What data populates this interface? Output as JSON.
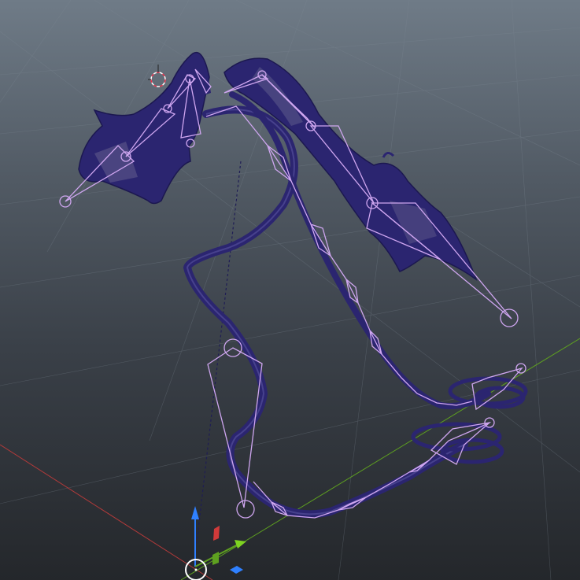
{
  "viewport": {
    "view": "perspective",
    "selection_state": "rigged-model",
    "colors": {
      "background_top": "#6f7b87",
      "background_bottom": "#24272b",
      "grid_line": "#7a8590",
      "mesh": "#2a2470",
      "bone": "#cfa6f0",
      "x_axis": "#b23a3a",
      "y_axis": "#5ea020",
      "z_axis": "#2f80ff",
      "cursor_red": "#e0304a"
    }
  },
  "objects": {
    "wing_left": "left-wing-mesh",
    "wing_right": "right-wing-mesh",
    "tail": "tail-mesh",
    "rig": "armature"
  },
  "gizmo": {
    "icons": [
      "move-gizmo-icon",
      "3d-cursor-icon"
    ]
  }
}
